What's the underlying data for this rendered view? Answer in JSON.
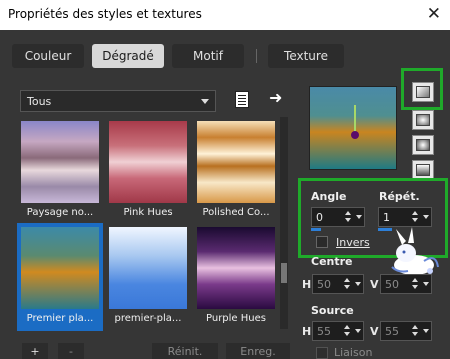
{
  "window": {
    "title": "Propriétés des styles et textures",
    "close_glyph": "✕"
  },
  "tabs": [
    {
      "label": "Couleur",
      "active": false
    },
    {
      "label": "Dégradé",
      "active": true
    },
    {
      "label": "Motif",
      "active": false
    },
    {
      "label": "Texture",
      "active": false
    }
  ],
  "category_select": {
    "value": "Tous"
  },
  "toolbar": {
    "arrow_glyph": "➜",
    "doc_icon": "gradient-editor-icon"
  },
  "gradients": [
    {
      "label": "Paysage no..."
    },
    {
      "label": "Pink Hues"
    },
    {
      "label": "Polished Co..."
    },
    {
      "label": "Premier pla...",
      "selected": true
    },
    {
      "label": "premier-pla..."
    },
    {
      "label": "Purple Hues"
    }
  ],
  "angle": {
    "label": "Angle",
    "value": "0"
  },
  "repeat": {
    "label": "Répét.",
    "value": "1"
  },
  "invert": {
    "label": "Invers",
    "checked": false
  },
  "center": {
    "label": "Centre",
    "h_label": "H",
    "h_value": "50",
    "v_label": "V",
    "v_value": "50"
  },
  "source": {
    "label": "Source",
    "h_label": "H",
    "h_value": "55",
    "v_label": "V",
    "v_value": "55"
  },
  "link": {
    "label": "Liaison"
  },
  "bottom": {
    "add": "+",
    "remove": "-",
    "reset": "Réinit.",
    "save": "Enreg."
  },
  "colors": {
    "highlight": "#1faa2a",
    "selection": "#1b6cc4",
    "background": "#363636"
  }
}
